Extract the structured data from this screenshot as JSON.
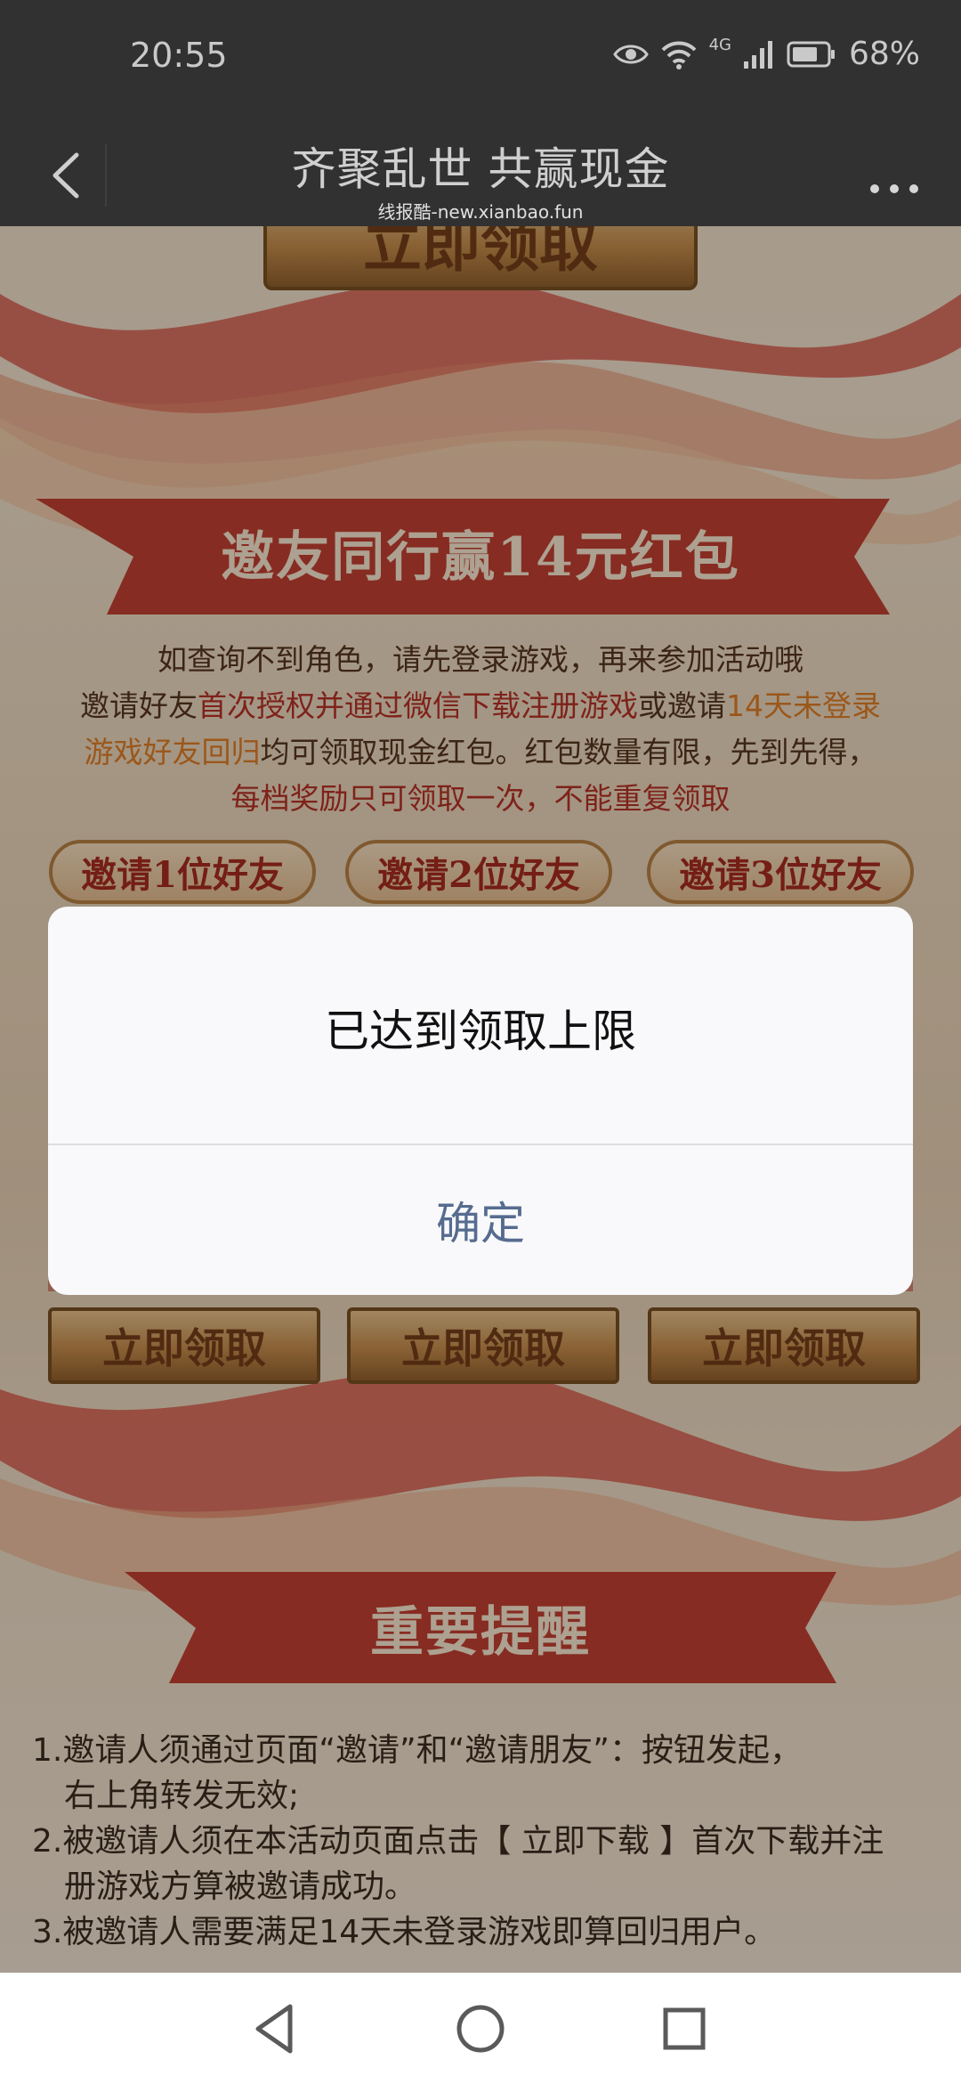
{
  "status_bar": {
    "time": "20:55",
    "network": "4G",
    "battery": "68%"
  },
  "title_bar": {
    "title": "齐聚乱世 共赢现金",
    "subtitle": "线报酷-new.xianbao.fun"
  },
  "page": {
    "top_claim_label": "立即领取",
    "banner_title": "邀友同行赢14元红包",
    "desc": {
      "line1": "如查询不到角色，请先登录游戏，再来参加活动哦",
      "line2_a": "邀请好友",
      "line2_b": "首次授权并通过微信下载注册游戏",
      "line2_c": "或邀请",
      "line2_d": "14天未登录",
      "line3_a": "游戏好友回归",
      "line3_b": "均可领取现金红包。红包数量有限，先到先得，",
      "line4": "每档奖励只可领取一次，不能重复领取"
    },
    "tabs": [
      "邀请1位好友",
      "邀请2位好友",
      "邀请3位好友"
    ],
    "claim_buttons": [
      "立即领取",
      "立即领取",
      "立即领取"
    ],
    "reminder_title": "重要提醒",
    "reminders": [
      {
        "line1": "1.邀请人须通过页面“邀请”和“邀请朋友”：按钮发起，",
        "line2": "右上角转发无效;"
      },
      {
        "line1": "2.被邀请人须在本活动页面点击【 立即下载 】首次下载并注",
        "line2": "册游戏方算被邀请成功。"
      },
      {
        "line1": "3.被邀请人需要满足14天未登录游戏即算回归用户。",
        "line2": ""
      }
    ]
  },
  "dialog": {
    "message": "已达到领取上限",
    "confirm_label": "确定"
  },
  "colors": {
    "bar_bg": "#313131",
    "banner_red": "#c2362b",
    "gold": "#c38a45",
    "dialog_btn": "#566c8f"
  },
  "icons": {
    "back": "chevron-left-icon",
    "more": "more-dots-icon",
    "nav_back": "triangle-back-icon",
    "nav_home": "circle-home-icon",
    "nav_recents": "square-recents-icon"
  }
}
